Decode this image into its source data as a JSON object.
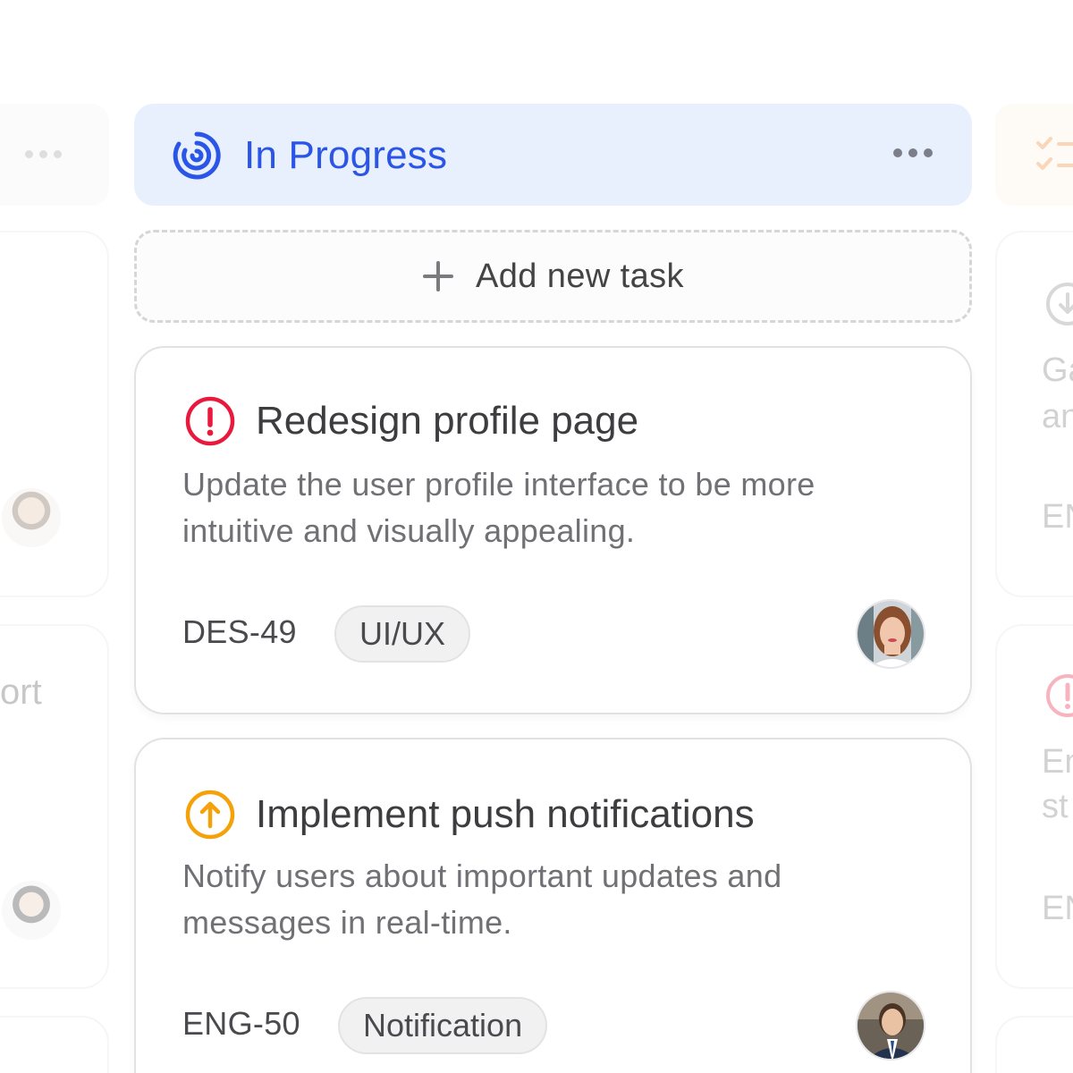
{
  "left_column": {
    "partial_text": "ort"
  },
  "right_column": {
    "partial_texts": [
      "Ga",
      "an",
      "EN",
      "En",
      "st",
      "EN"
    ]
  },
  "column": {
    "title": "In Progress",
    "accent_color": "#2b55e6",
    "header_bg": "#e8effd",
    "status_icon": "in-progress-spiral-icon",
    "menu_icon": "more-horizontal-icon"
  },
  "add_task": {
    "label": "Add new task",
    "icon": "plus-icon"
  },
  "cards": [
    {
      "title": "Redesign profile page",
      "description": "Update the user profile interface to be more intuitive and visually appealing.",
      "code": "DES-49",
      "tag": "UI/UX",
      "priority_icon": "urgent-alert-icon",
      "priority_color": "#e8193c",
      "avatar": "woman-avatar"
    },
    {
      "title": "Implement push notifications",
      "description": "Notify users about important updates and messages in real-time.",
      "code": "ENG-50",
      "tag": "Notification",
      "priority_icon": "high-priority-arrow-up-icon",
      "priority_color": "#f5a20a",
      "avatar": "man-avatar"
    }
  ]
}
